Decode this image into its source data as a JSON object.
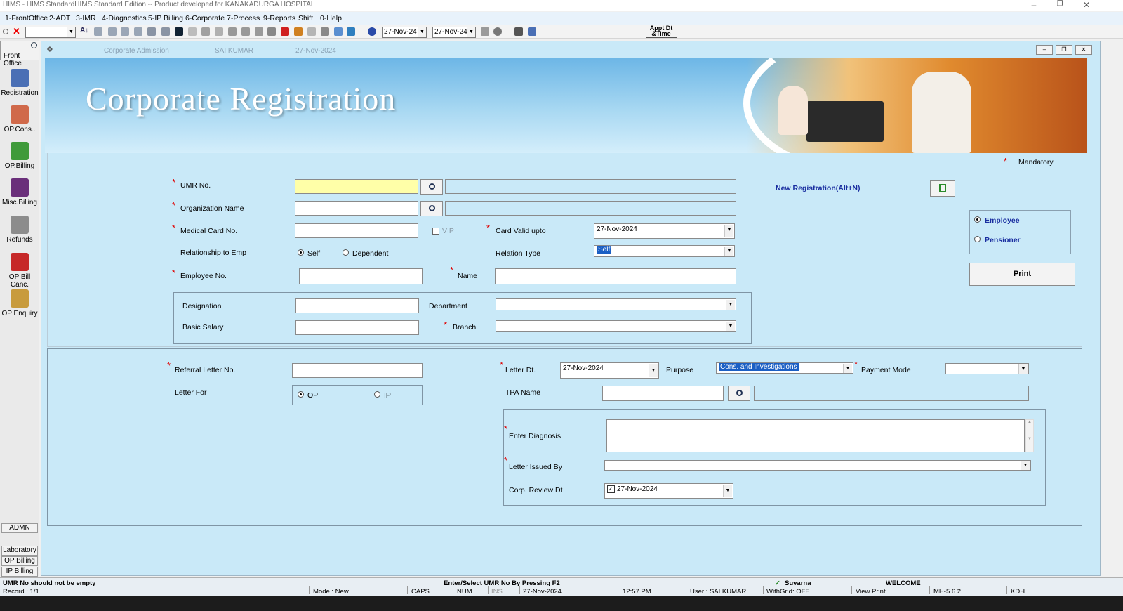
{
  "window": {
    "title": "HIMS - HIMS StandardHIMS Standard Edition -- Product developed for KANAKADURGA HOSPITAL"
  },
  "menu": [
    "1-FrontOffice",
    "2-ADT",
    "3-IMR",
    "4-Diagnostics",
    "5-IP Billing",
    "6-Corporate",
    "7-Process",
    "9-Reports",
    "Shift",
    "0-Help"
  ],
  "toolbar": {
    "date_from": "27-Nov-24",
    "date_to": "27-Nov-24",
    "appt_label_1": "Appt Dt",
    "appt_label_2": "&Time"
  },
  "sidebar": {
    "header": "Front Office",
    "items": [
      {
        "label": "Registration",
        "icon": "registration-icon",
        "color": "#4a6fb5"
      },
      {
        "label": "OP.Cons..",
        "icon": "op-consultation-icon",
        "color": "#d0694a"
      },
      {
        "label": "OP.Billing",
        "icon": "op-billing-icon",
        "color": "#3f9a3a"
      },
      {
        "label": "Misc.Billing",
        "icon": "misc-billing-icon",
        "color": "#6a2f7a"
      },
      {
        "label": "Refunds",
        "icon": "refunds-icon",
        "color": "#8c8c8c"
      },
      {
        "label": "OP Bill Canc.",
        "icon": "op-bill-cancel-icon",
        "color": "#c62828"
      },
      {
        "label": "OP Enquiry",
        "icon": "op-enquiry-icon",
        "color": "#c89b3c"
      }
    ],
    "bottom_buttons": [
      "ADMN",
      "Laboratory",
      "OP Billing",
      "IP Billing"
    ]
  },
  "form_header": {
    "module": "Corporate Admission",
    "user": "SAI KUMAR",
    "date": "27-Nov-2024"
  },
  "banner": {
    "title": "Corporate Registration"
  },
  "form": {
    "mandatory_label": "Mandatory",
    "new_registration_label": "New Registration(Alt+N)",
    "umr_label": "UMR No.",
    "umr_value": "",
    "org_label": "Organization Name",
    "org_value": "",
    "medical_card_label": "Medical Card No.",
    "medical_card_value": "",
    "vip_label": "VIP",
    "card_valid_label": "Card Valid upto",
    "card_valid_value": "27-Nov-2024",
    "relationship_label": "Relationship to Emp",
    "relationship_options": [
      "Self",
      "Dependent"
    ],
    "relationship_selected": "Self",
    "relation_type_label": "Relation Type",
    "relation_type_value": "Self",
    "employee_no_label": "Employee No.",
    "employee_no_value": "",
    "name_label": "Name",
    "name_value": "",
    "designation_label": "Designation",
    "designation_value": "",
    "department_label": "Department",
    "department_value": "",
    "basic_salary_label": "Basic Salary",
    "basic_salary_value": "",
    "branch_label": "Branch",
    "branch_value": "",
    "employee_type_options": [
      "Employee",
      "Pensioner"
    ],
    "employee_type_selected": "Employee",
    "print_label": "Print"
  },
  "referral": {
    "letter_no_label": "Referral Letter No.",
    "letter_no_value": "",
    "letter_for_label": "Letter For",
    "letter_for_options": [
      "OP",
      "IP"
    ],
    "letter_for_selected": "OP",
    "letter_dt_label": "Letter Dt.",
    "letter_dt_value": "27-Nov-2024",
    "purpose_label": "Purpose",
    "purpose_value": "Cons. and Investigations",
    "payment_mode_label": "Payment Mode",
    "payment_mode_value": "",
    "tpa_label": "TPA Name",
    "tpa_value": "",
    "diagnosis_label": "Enter Diagnosis",
    "diagnosis_value": "",
    "issued_by_label": "Letter Issued By",
    "issued_by_value": "",
    "review_dt_label": "Corp. Review Dt",
    "review_dt_value": "27-Nov-2024"
  },
  "status": {
    "message": "UMR No should not be empty",
    "hint": "Enter/Select  UMR No By Pressing F2",
    "server": "Suvarna",
    "welcome": "WELCOME",
    "record": "Record : 1/1",
    "mode": "Mode : New",
    "caps": "CAPS",
    "num": "NUM",
    "ins": "INS",
    "date": "27-Nov-2024",
    "time": "12:57 PM",
    "user": "User : SAI KUMAR",
    "withgrid": "WithGrid: OFF",
    "view_print": "View Print",
    "version": "MH-5.6.2",
    "site": "KDH"
  },
  "colors": {
    "form_bg": "#c9e9f8",
    "umr_highlight": "#ffffa8",
    "required_star": "#e00000",
    "link_blue": "#1a2ea0"
  }
}
